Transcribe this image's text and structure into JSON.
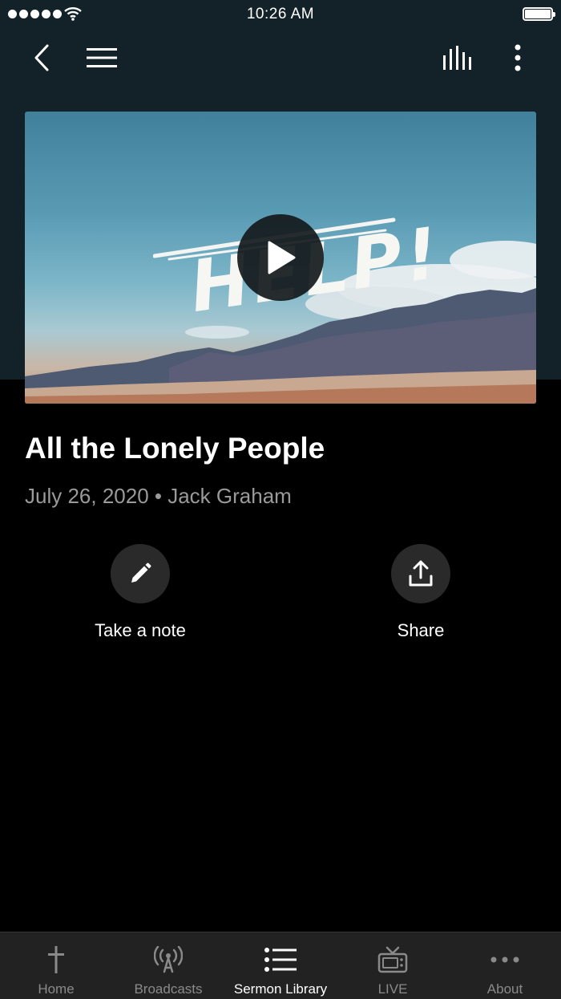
{
  "status_bar": {
    "time": "10:26 AM"
  },
  "nav": {
    "back_icon": "chevron-left-icon",
    "menu_icon": "hamburger-icon",
    "audio_icon": "audio-bars-icon",
    "more_icon": "vertical-dots-icon"
  },
  "hero": {
    "overlay_text": "HELP!",
    "play_icon": "play-icon"
  },
  "sermon": {
    "title": "All the Lonely People",
    "meta": "July 26, 2020 • Jack Graham"
  },
  "actions": [
    {
      "label": "Take a note",
      "icon": "pencil-icon"
    },
    {
      "label": "Share",
      "icon": "share-icon"
    }
  ],
  "tabs": [
    {
      "label": "Home",
      "icon": "cross-icon",
      "active": false
    },
    {
      "label": "Broadcasts",
      "icon": "broadcast-icon",
      "active": false
    },
    {
      "label": "Sermon Library",
      "icon": "list-icon",
      "active": true
    },
    {
      "label": "LIVE",
      "icon": "tv-icon",
      "active": false
    },
    {
      "label": "About",
      "icon": "more-horizontal-icon",
      "active": false
    }
  ],
  "colors": {
    "header_bg": "#132229",
    "page_bg": "#000000",
    "tab_bar_bg": "#222222",
    "muted_text": "#9a9a9a"
  }
}
